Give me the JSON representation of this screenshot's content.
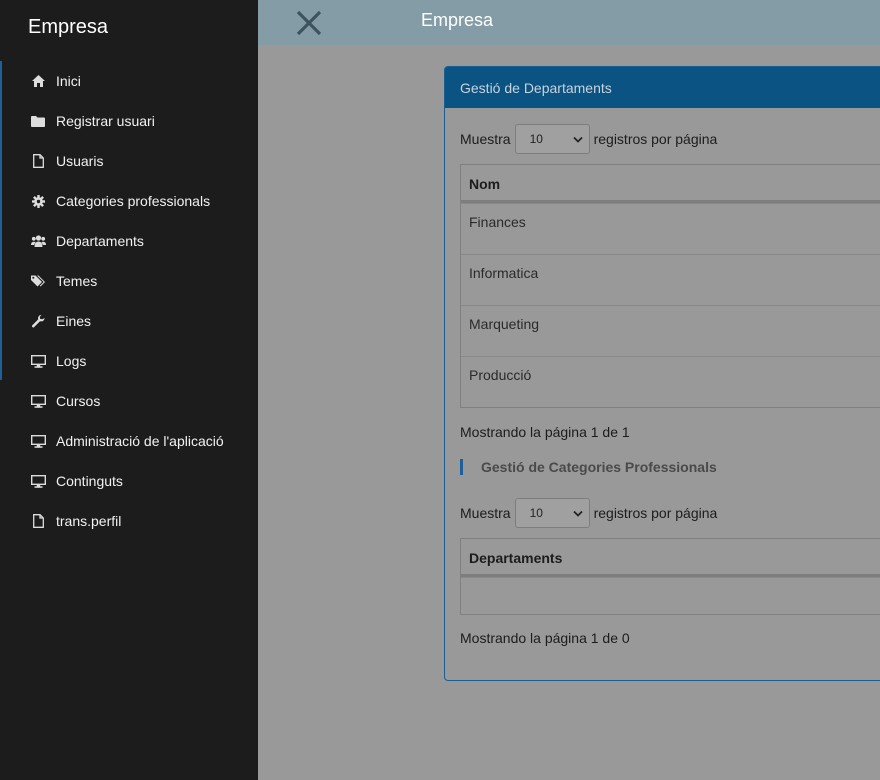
{
  "sidebar": {
    "brand": "Empresa",
    "items": [
      {
        "label": "Inici",
        "icon": "home-icon"
      },
      {
        "label": "Registrar usuari",
        "icon": "folder-icon"
      },
      {
        "label": "Usuaris",
        "icon": "file-icon"
      },
      {
        "label": "Categories professionals",
        "icon": "gear-icon"
      },
      {
        "label": "Departaments",
        "icon": "users-icon"
      },
      {
        "label": "Temes",
        "icon": "tags-icon"
      },
      {
        "label": "Eines",
        "icon": "wrench-icon"
      },
      {
        "label": "Logs",
        "icon": "monitor-icon"
      },
      {
        "label": "Cursos",
        "icon": "monitor-icon"
      },
      {
        "label": "Administració de l'aplicació",
        "icon": "monitor-icon"
      },
      {
        "label": "Continguts",
        "icon": "monitor-icon"
      },
      {
        "label": "trans.perfil",
        "icon": "file-icon"
      }
    ]
  },
  "topbar": {
    "title": "Empresa",
    "close_icon": "close-icon"
  },
  "panel": {
    "title": "Gestió de Departaments",
    "departments": {
      "length": {
        "prefix": "Muestra",
        "value": "10",
        "suffix": "registros por página"
      },
      "header": "Nom",
      "rows": [
        "Finances",
        "Informatica",
        "Marqueting",
        "Producció"
      ],
      "info": "Mostrando la página 1 de 1"
    },
    "categories": {
      "title": "Gestió de Categories Professionals",
      "length": {
        "prefix": "Muestra",
        "value": "10",
        "suffix": "registros por página"
      },
      "header": "Departaments",
      "info": "Mostrando la página 1 de 0"
    }
  },
  "colors": {
    "sidebar_bg": "#1c1c1c",
    "topbar_bg": "#839ca5",
    "card_header_bg": "#0b5383",
    "overlay_bg": "#999999",
    "accent": "#1f5f9a"
  }
}
